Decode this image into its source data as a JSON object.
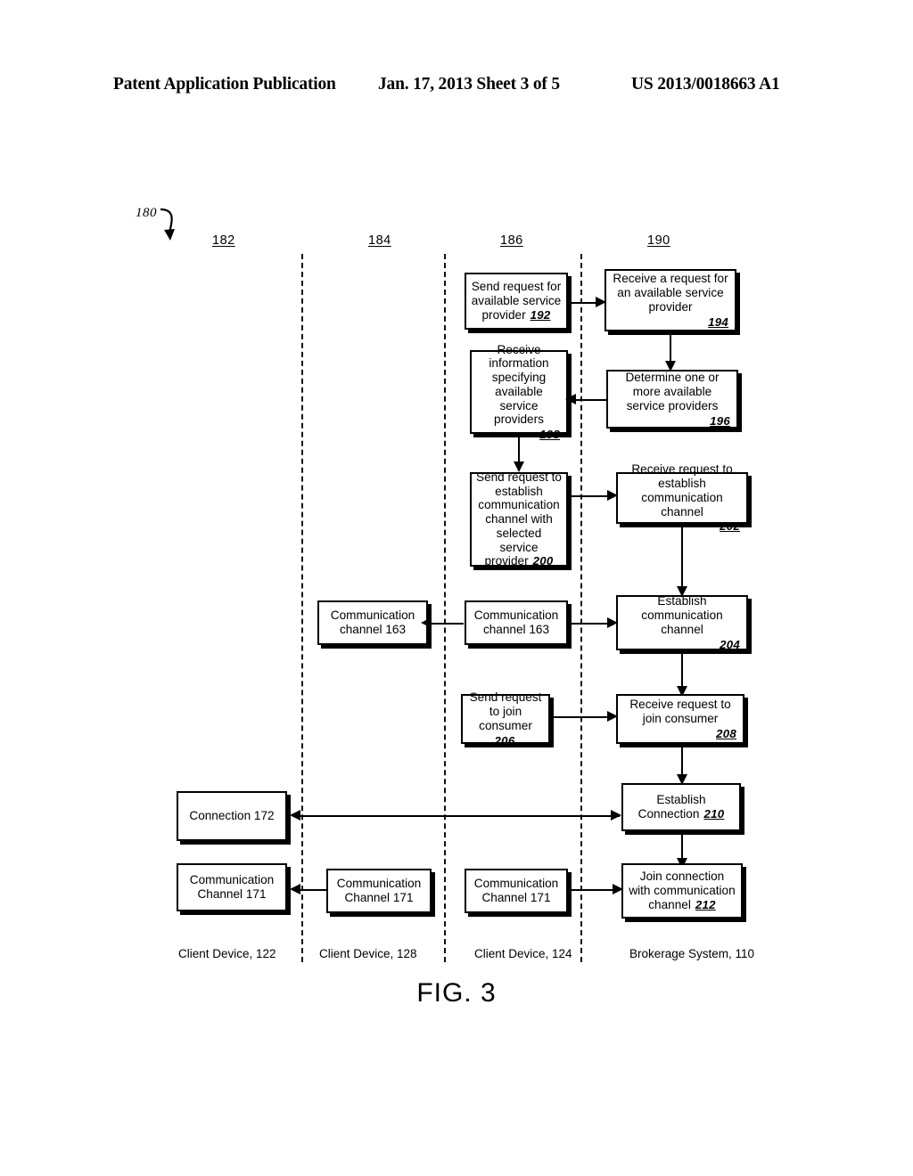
{
  "header": {
    "left": "Patent Application Publication",
    "center": "Jan. 17, 2013  Sheet 3 of 5",
    "right": "US 2013/0018663 A1"
  },
  "figure": {
    "caption": "FIG. 3",
    "diagram_ref": "180",
    "lanes": [
      {
        "number": "182",
        "caption": "Client Device, 122"
      },
      {
        "number": "184",
        "caption": "Client Device, 128"
      },
      {
        "number": "186",
        "caption": "Client Device, 124"
      },
      {
        "number": "190",
        "caption": "Brokerage System, 110"
      }
    ],
    "boxes": {
      "b192": {
        "text": "Send request for available service provider",
        "ref": "192"
      },
      "b194": {
        "text": "Receive a request for an available service provider",
        "ref": "194"
      },
      "b198": {
        "text": "Receive information specifying available service providers",
        "ref": "198"
      },
      "b196": {
        "text": "Determine one or more available service providers",
        "ref": "196"
      },
      "b200": {
        "text": "Send request to establish communication channel with selected service provider",
        "ref": "200"
      },
      "b202": {
        "text": "Receive request to establish communication channel",
        "ref": "202"
      },
      "cc163_a": {
        "text": "Communication channel 163",
        "ref": ""
      },
      "cc163_b": {
        "text": "Communication channel 163",
        "ref": ""
      },
      "b204": {
        "text": "Establish communication channel",
        "ref": "204"
      },
      "b206": {
        "text": "Send request to join consumer",
        "ref": "206"
      },
      "b208": {
        "text": "Receive request to join consumer",
        "ref": "208"
      },
      "conn172": {
        "text": "Connection 172",
        "ref": ""
      },
      "b210": {
        "text": "Establish Connection",
        "ref": "210"
      },
      "cc171_a": {
        "text": "Communication Channel 171",
        "ref": ""
      },
      "cc171_b": {
        "text": "Communication Channel 171",
        "ref": ""
      },
      "cc171_c": {
        "text": "Communication Channel 171",
        "ref": ""
      },
      "b212": {
        "text": "Join connection with communication channel",
        "ref": "212"
      }
    }
  },
  "chart_data": {
    "type": "diagram",
    "title": "FIG. 3",
    "diagram_kind": "swimlane-flowchart",
    "lanes": [
      "Client Device, 122",
      "Client Device, 128",
      "Client Device, 124",
      "Brokerage System, 110"
    ],
    "nodes": [
      {
        "id": "192",
        "lane": "Client Device, 124",
        "label": "Send request for available service provider"
      },
      {
        "id": "194",
        "lane": "Brokerage System, 110",
        "label": "Receive a request for an available service provider"
      },
      {
        "id": "196",
        "lane": "Brokerage System, 110",
        "label": "Determine one or more available service providers"
      },
      {
        "id": "198",
        "lane": "Client Device, 124",
        "label": "Receive information specifying available service providers"
      },
      {
        "id": "200",
        "lane": "Client Device, 124",
        "label": "Send request to establish communication channel with selected service provider"
      },
      {
        "id": "202",
        "lane": "Brokerage System, 110",
        "label": "Receive request to establish communication channel"
      },
      {
        "id": "204",
        "lane": "Brokerage System, 110",
        "label": "Establish communication channel"
      },
      {
        "id": "163a",
        "lane": "Client Device, 124",
        "label": "Communication channel 163"
      },
      {
        "id": "163b",
        "lane": "Client Device, 128",
        "label": "Communication channel 163"
      },
      {
        "id": "206",
        "lane": "Client Device, 124",
        "label": "Send request to join consumer"
      },
      {
        "id": "208",
        "lane": "Brokerage System, 110",
        "label": "Receive request to join consumer"
      },
      {
        "id": "210",
        "lane": "Brokerage System, 110",
        "label": "Establish Connection"
      },
      {
        "id": "172",
        "lane": "Client Device, 122",
        "label": "Connection 172"
      },
      {
        "id": "212",
        "lane": "Brokerage System, 110",
        "label": "Join connection with communication channel"
      },
      {
        "id": "171a",
        "lane": "Client Device, 122",
        "label": "Communication Channel 171"
      },
      {
        "id": "171b",
        "lane": "Client Device, 128",
        "label": "Communication Channel 171"
      },
      {
        "id": "171c",
        "lane": "Client Device, 124",
        "label": "Communication Channel 171"
      }
    ],
    "edges": [
      {
        "from": "192",
        "to": "194",
        "dir": "right"
      },
      {
        "from": "194",
        "to": "196",
        "dir": "down"
      },
      {
        "from": "196",
        "to": "198",
        "dir": "left"
      },
      {
        "from": "198",
        "to": "200",
        "dir": "down"
      },
      {
        "from": "200",
        "to": "202",
        "dir": "right"
      },
      {
        "from": "202",
        "to": "204",
        "dir": "down"
      },
      {
        "from": "204",
        "to": "163a",
        "dir": "left"
      },
      {
        "from": "163a",
        "to": "163b",
        "dir": "left"
      },
      {
        "from": "204",
        "to": "208",
        "dir": "down"
      },
      {
        "from": "206",
        "to": "208",
        "dir": "right"
      },
      {
        "from": "208",
        "to": "210",
        "dir": "down"
      },
      {
        "from": "210",
        "to": "172",
        "dir": "bidirectional"
      },
      {
        "from": "210",
        "to": "212",
        "dir": "down"
      },
      {
        "from": "171c",
        "to": "212",
        "dir": "right"
      },
      {
        "from": "171b",
        "to": "171a",
        "dir": "left"
      }
    ]
  }
}
